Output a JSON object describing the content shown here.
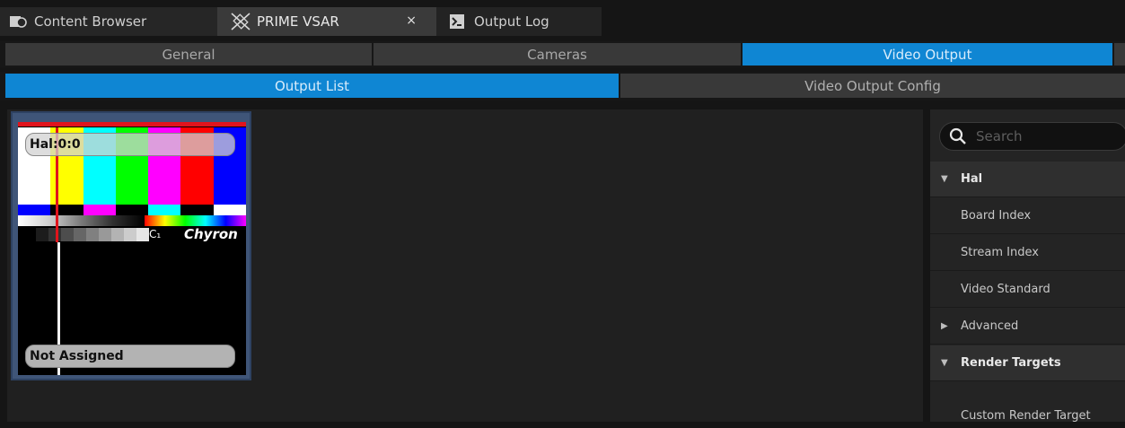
{
  "doc_tabs": [
    {
      "label": "Content Browser",
      "icon": "content-browser-icon"
    },
    {
      "label": "PRIME VSAR",
      "icon": "prime-vsar-icon",
      "close": "×"
    },
    {
      "label": "Output Log",
      "icon": "output-log-icon"
    }
  ],
  "main_tabs": [
    "General",
    "Cameras",
    "Video Output"
  ],
  "sub_tabs": [
    "Output List",
    "Video Output Config"
  ],
  "output_card": {
    "top_label": "Hal:0:0",
    "bottom_label": "Not Assigned",
    "brand": "Chyron",
    "brand_mark": "C₁"
  },
  "search": {
    "placeholder": "Search"
  },
  "details": {
    "hal": "Hal",
    "board_index": "Board Index",
    "stream_index": "Stream Index",
    "video_standard": "Video Standard",
    "advanced": "Advanced",
    "render_targets": "Render Targets",
    "custom_render_target": "Custom Render Target"
  },
  "colors": {
    "accent": "#0f86d3",
    "card_border": "#3f5578"
  }
}
